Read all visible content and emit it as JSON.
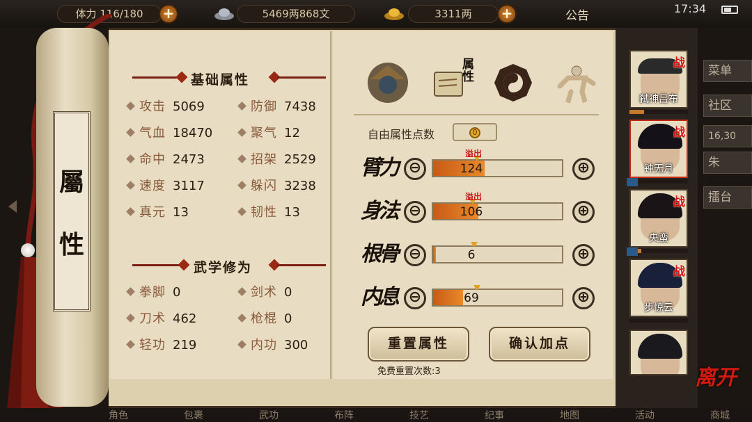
{
  "top_bar": {
    "stamina_label": "体力",
    "stamina": "116/180",
    "silver": "5469两868文",
    "gold": "3311两",
    "notice": "公告",
    "clock": "17:34"
  },
  "background_tabs": [
    "菜单",
    "社区",
    "16,30",
    "朱",
    "擂台"
  ],
  "scroll": {
    "title_chars": [
      "屬",
      "性"
    ]
  },
  "basic_section": {
    "title": "基础属性",
    "stats": [
      {
        "label": "攻击",
        "value": "5069"
      },
      {
        "label": "防御",
        "value": "7438"
      },
      {
        "label": "气血",
        "value": "18470"
      },
      {
        "label": "聚气",
        "value": "12"
      },
      {
        "label": "命中",
        "value": "2473"
      },
      {
        "label": "招架",
        "value": "2529"
      },
      {
        "label": "速度",
        "value": "3117"
      },
      {
        "label": "躲闪",
        "value": "3238"
      },
      {
        "label": "真元",
        "value": "13"
      },
      {
        "label": "韧性",
        "value": "13"
      }
    ]
  },
  "martial_section": {
    "title": "武学修为",
    "stats": [
      {
        "label": "拳脚",
        "value": "0"
      },
      {
        "label": "剑术",
        "value": "0"
      },
      {
        "label": "刀术",
        "value": "462"
      },
      {
        "label": "枪棍",
        "value": "0"
      },
      {
        "label": "轻功",
        "value": "219"
      },
      {
        "label": "内功",
        "value": "300"
      }
    ]
  },
  "tabs": {
    "icons": [
      "hero-portrait-icon",
      "attribute-scroll-icon",
      "bagua-icon",
      "meridian-body-icon"
    ],
    "attribute_tab_label": "属性"
  },
  "free_points": {
    "label": "自由属性点数",
    "value": "0"
  },
  "attributes": [
    {
      "name": "臂力",
      "value": "124",
      "fill": 0.4,
      "marker": 0.34,
      "overflow": "溢出"
    },
    {
      "name": "身法",
      "value": "106",
      "fill": 0.35,
      "marker": 0.31,
      "overflow": "溢出"
    },
    {
      "name": "根骨",
      "value": "6",
      "fill": 0.02,
      "marker": 0.32,
      "overflow": ""
    },
    {
      "name": "内息",
      "value": "69",
      "fill": 0.23,
      "marker": 0.34,
      "overflow": ""
    }
  ],
  "buttons": {
    "reset": "重置属性",
    "confirm": "确认加点",
    "reset_note": "免费重置次数:3",
    "minus": "⊖",
    "plus": "⊕"
  },
  "characters": [
    {
      "name": "弑神吕布",
      "tag": "战",
      "exp": 0.25,
      "xiu": false
    },
    {
      "name": "钟无月",
      "tag": "战",
      "exp": 0.0,
      "xiu": true
    },
    {
      "name": "央蛮",
      "tag": "战",
      "exp": 0.2,
      "xiu": true
    },
    {
      "name": "步惊云",
      "tag": "战",
      "exp": 0.0,
      "xiu": false
    },
    {
      "name": "",
      "tag": "",
      "exp": 0.0,
      "xiu": false
    }
  ],
  "leave_label": "离开",
  "bottom_nav": [
    "角色",
    "包裹",
    "武功",
    "布阵",
    "技艺",
    "纪事",
    "地图",
    "活动",
    "商城"
  ],
  "colors": {
    "accent_red": "#c22d1a",
    "bar_orange": "#e07a24",
    "paper": "#e8ddc3"
  }
}
